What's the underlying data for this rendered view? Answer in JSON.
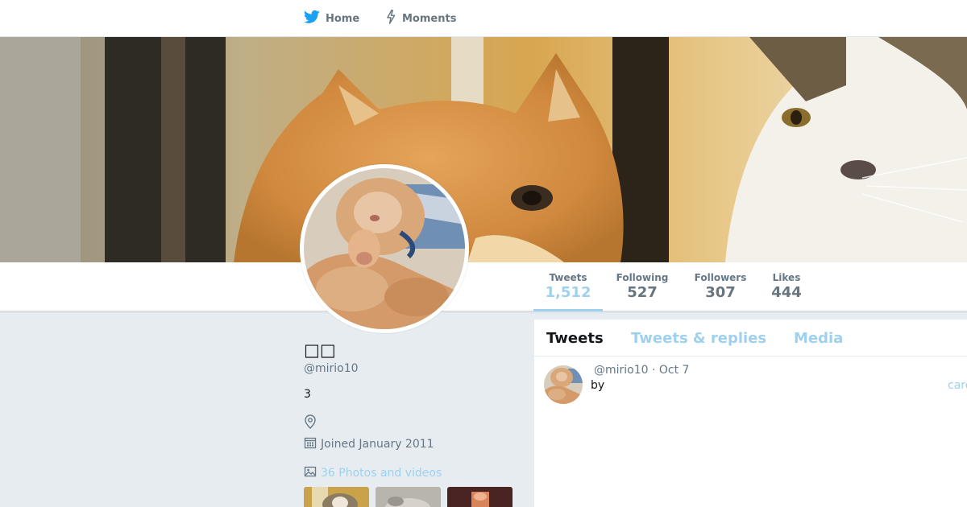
{
  "nav": {
    "home_label": "Home",
    "moments_label": "Moments",
    "brand_color": "#1da1f2"
  },
  "stats": {
    "tweets_label": "Tweets",
    "tweets_value": "1,512",
    "following_label": "Following",
    "following_value": "527",
    "followers_label": "Followers",
    "followers_value": "307",
    "likes_label": "Likes",
    "likes_value": "444"
  },
  "profile": {
    "name": "□□",
    "handle": "@mirio10",
    "bio": "3",
    "joined": "Joined January 2011",
    "photos_link": "36 Photos and videos"
  },
  "timeline": {
    "tabs": [
      "Tweets",
      "Tweets & replies",
      "Media"
    ],
    "tweet": {
      "meta": "@mirio10 · Oct 7",
      "text": "by",
      "link_fragment": "carc"
    }
  },
  "colors": {
    "accent_light": "#9fd0ee",
    "text_primary": "#14171a",
    "text_secondary": "#657786",
    "page_bg": "#e6ecf0"
  }
}
